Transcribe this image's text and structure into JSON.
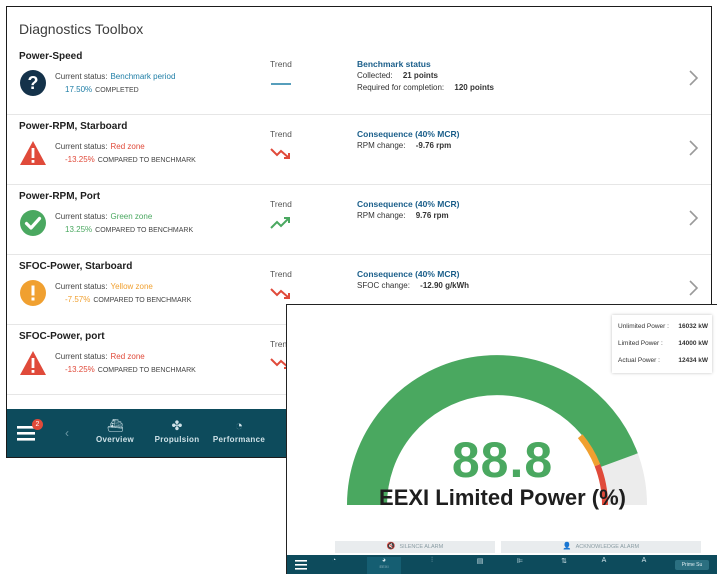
{
  "app_title": "Diagnostics Toolbox",
  "colors": {
    "red": "#e04a3a",
    "green": "#4aa860",
    "yellow": "#f0a030",
    "navy": "#14324a",
    "accent": "#1a5e8a",
    "bar": "#0d4b5c"
  },
  "rows": [
    {
      "title": "Power-Speed",
      "icon": "question-circle-icon",
      "status_prefix": "Current status:",
      "status_value": "Benchmark period",
      "status_color": "#1f7ea6",
      "percent": "17.50%",
      "percent_suffix": "COMPLETED",
      "trend_label": "Trend",
      "trend_icon": "flat-line-icon",
      "consequence_title": "Benchmark status",
      "lines": [
        {
          "label": "Collected:",
          "value": "21 points"
        },
        {
          "label": "Required for completion:",
          "value": "120 points"
        }
      ]
    },
    {
      "title": "Power-RPM, Starboard",
      "icon": "warning-triangle-icon",
      "status_prefix": "Current status:",
      "status_value": "Red zone",
      "status_color": "#e04a3a",
      "percent": "-13.25%",
      "percent_suffix": "COMPARED TO BENCHMARK",
      "trend_label": "Trend",
      "trend_icon": "trend-down-icon",
      "consequence_title": "Consequence (40% MCR)",
      "lines": [
        {
          "label": "RPM change:",
          "value": "-9.76 rpm"
        }
      ]
    },
    {
      "title": "Power-RPM, Port",
      "icon": "check-circle-icon",
      "status_prefix": "Current status:",
      "status_value": "Green zone",
      "status_color": "#4aa860",
      "percent": "13.25%",
      "percent_suffix": "COMPARED TO BENCHMARK",
      "trend_label": "Trend",
      "trend_icon": "trend-up-icon",
      "consequence_title": "Consequence (40% MCR)",
      "lines": [
        {
          "label": "RPM change:",
          "value": "9.76 rpm"
        }
      ]
    },
    {
      "title": "SFOC-Power, Starboard",
      "icon": "exclamation-circle-icon",
      "status_prefix": "Current status:",
      "status_value": "Yellow zone",
      "status_color": "#f0a030",
      "percent": "-7.57%",
      "percent_suffix": "COMPARED TO BENCHMARK",
      "trend_label": "Trend",
      "trend_icon": "trend-down-icon",
      "consequence_title": "Consequence (40% MCR)",
      "lines": [
        {
          "label": "SFOC change:",
          "value": "-12.90 g/kWh"
        }
      ]
    },
    {
      "title": "SFOC-Power, port",
      "icon": "warning-triangle-icon",
      "status_prefix": "Current status:",
      "status_value": "Red zone",
      "status_color": "#e04a3a",
      "percent": "-13.25%",
      "percent_suffix": "COMPARED TO BENCHMARK",
      "trend_label": "Trend",
      "trend_icon": "trend-down-icon",
      "consequence_title": "",
      "lines": []
    }
  ],
  "left_nav": {
    "badge": "2",
    "items": [
      {
        "label": "Overview",
        "icon": "ship-icon"
      },
      {
        "label": "Propulsion",
        "icon": "propeller-icon"
      },
      {
        "label": "Performance",
        "icon": "speedometer-icon"
      }
    ]
  },
  "eexi": {
    "power_panel": [
      {
        "label": "Unlimited Power :",
        "value": "16032 kW"
      },
      {
        "label": "Limited Power :",
        "value": "14000 kW"
      },
      {
        "label": "Actual Power :",
        "value": "12434 kW"
      }
    ],
    "gauge_value": "88.8",
    "gauge_fraction": 0.888,
    "gauge_label": "EEXI Limited Power (%)",
    "alarm_buttons": [
      {
        "label": "SILENCE ALARM",
        "icon": "speaker-mute-icon"
      },
      {
        "label": "ACKNOWLEDGE ALARM",
        "icon": "user-check-icon"
      }
    ],
    "nav_items": [
      {
        "label": "",
        "icon": "speedometer-icon"
      },
      {
        "label": "EEXI",
        "icon": "speedometer-icon",
        "active": true
      },
      {
        "label": "",
        "icon": "chart-icon"
      },
      {
        "label": "",
        "icon": "list-icon"
      },
      {
        "label": "",
        "icon": "bar-icon"
      },
      {
        "label": "",
        "icon": "sort-icon"
      },
      {
        "label": "",
        "icon": "text-icon"
      },
      {
        "label": "",
        "icon": "text-icon"
      }
    ],
    "chip": "Prime Su"
  }
}
